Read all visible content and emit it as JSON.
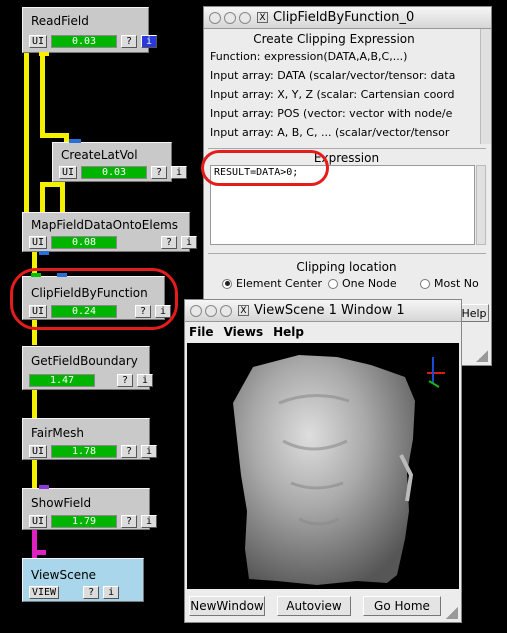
{
  "network": {
    "modules": [
      {
        "id": "readfield",
        "title": "ReadField",
        "ui": "UI",
        "progress": "0.03",
        "q": "?",
        "i": "i"
      },
      {
        "id": "createlatvol",
        "title": "CreateLatVol",
        "ui": "UI",
        "progress": "0.03",
        "q": "?",
        "i": "i"
      },
      {
        "id": "mapfield",
        "title": "MapFieldDataOntoElems",
        "ui": "UI",
        "progress": "0.08",
        "q": "?",
        "i": "i"
      },
      {
        "id": "clipfield",
        "title": "ClipFieldByFunction",
        "ui": "UI",
        "progress": "0.24",
        "q": "?",
        "i": "i"
      },
      {
        "id": "getboundary",
        "title": "GetFieldBoundary",
        "progress": "1.47",
        "q": "?",
        "i": "i"
      },
      {
        "id": "fairmesh",
        "title": "FairMesh",
        "ui": "UI",
        "progress": "1.78",
        "q": "?",
        "i": "i"
      },
      {
        "id": "showfield",
        "title": "ShowField",
        "ui": "UI",
        "progress": "1.79",
        "q": "?",
        "i": "i"
      },
      {
        "id": "viewscene",
        "title": "ViewScene",
        "ui": "VIEW",
        "q": "?",
        "i": "i"
      }
    ]
  },
  "clip_window": {
    "title": "ClipFieldByFunction_0",
    "section_title": "Create Clipping Expression",
    "info_lines": [
      "Function: expression(DATA,A,B,C,...)",
      "Input array: DATA (scalar/vector/tensor: data",
      "Input array: X, Y, Z (scalar: Cartensian coord",
      "Input array: POS (vector: vector with node/e",
      "Input array: A, B, C, ... (scalar/vector/tensor"
    ],
    "expression_label": "Expression",
    "expression_value": "RESULT=DATA>0;",
    "clip_location_title": "Clipping location",
    "radio_options": [
      "Element Center",
      "One Node",
      "Most No"
    ],
    "selected_option": "Element Center",
    "help_label": "Help"
  },
  "viewscene_window": {
    "title": "ViewScene 1 Window 1",
    "menu": [
      "File",
      "Views",
      "Help"
    ],
    "buttons": [
      "NewWindow",
      "Autoview",
      "Go Home"
    ]
  }
}
